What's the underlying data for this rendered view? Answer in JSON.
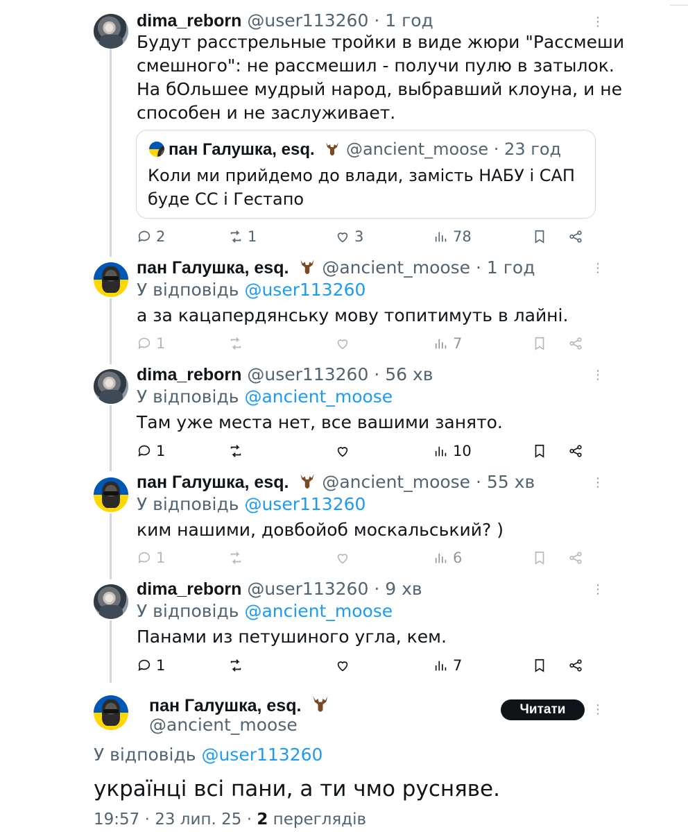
{
  "tweets": [
    {
      "name": "dima_reborn",
      "handle": "@user113260",
      "time": "1 год",
      "body_lines": [
        "Будут расстрельные тройки в виде жюри \"Рассмеши",
        "смешного\": не рассмешил - получи пулю в затылок.",
        "На бОльшее мудрый народ, выбравший клоуна, и не",
        "способен и не заслуживает."
      ],
      "quote": {
        "name": "пан Галушка, esq.",
        "handle": "@ancient_moose",
        "time": "23 год",
        "body_lines": [
          "Коли ми прийдемо до влади, замість НАБУ і САП",
          "буде СС і Гестапо"
        ]
      },
      "replies": "2",
      "reposts": "1",
      "likes": "3",
      "views": "78"
    },
    {
      "name": "пан Галушка, esq.",
      "handle": "@ancient_moose",
      "time": "1 год",
      "reply_prefix": "У відповідь",
      "reply_to": "@user113260",
      "body": "а за кацапердянську мову топитимуть в лайні.",
      "replies": "1",
      "reposts": "",
      "likes": "",
      "views": "7"
    },
    {
      "name": "dima_reborn",
      "handle": "@user113260",
      "time": "56 хв",
      "reply_prefix": "У відповідь",
      "reply_to": "@ancient_moose",
      "body": "Там уже места нет, все вашими занято.",
      "replies": "1",
      "reposts": "",
      "likes": "",
      "views": "10"
    },
    {
      "name": "пан Галушка, esq.",
      "handle": "@ancient_moose",
      "time": "55 хв",
      "reply_prefix": "У відповідь",
      "reply_to": "@user113260",
      "body": "ким нашими, довбойоб москальський? )",
      "replies": "1",
      "reposts": "",
      "likes": "",
      "views": "6"
    },
    {
      "name": "dima_reborn",
      "handle": "@user113260",
      "time": "9 хв",
      "reply_prefix": "У відповідь",
      "reply_to": "@ancient_moose",
      "body": "Панами из петушиного угла, кем.",
      "replies": "1",
      "reposts": "",
      "likes": "",
      "views": "7"
    }
  ],
  "main": {
    "name": "пан Галушка, esq.",
    "handle": "@ancient_moose",
    "follow_label": "Читати",
    "reply_prefix": "У відповідь",
    "reply_to": "@user113260",
    "body": "українці всі пани, а ти чмо русняве.",
    "time": "19:57",
    "date": "23 лип. 25",
    "views_count": "2",
    "views_label": "переглядів"
  },
  "separator": "·",
  "icons": [
    "reply-icon",
    "repost-icon",
    "like-icon",
    "views-icon",
    "bookmark-icon",
    "share-icon",
    "more-icon",
    "moose-emoji"
  ],
  "colors": {
    "text": "#0f1419",
    "muted": "#536471",
    "link": "#1d9bf0",
    "border": "#cfd9de",
    "button": "#0f1419"
  }
}
